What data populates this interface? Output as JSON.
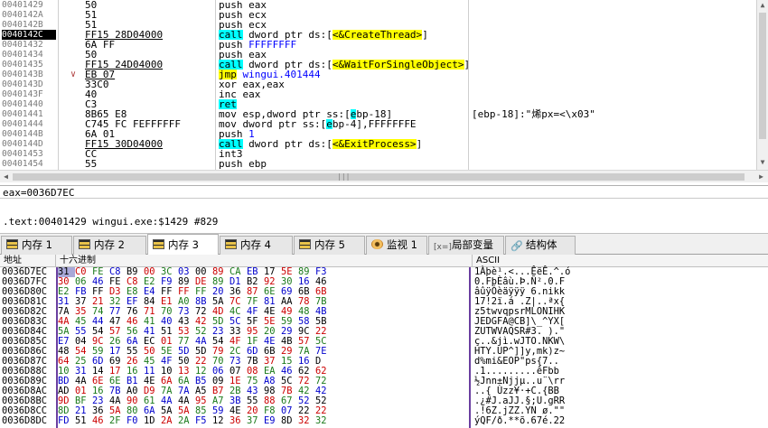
{
  "disasm": {
    "rows": [
      {
        "addr": "00401429",
        "arrow": "",
        "bytes": "50",
        "mnemonic": "push",
        "operand": "eax",
        "style": "push",
        "comment": ""
      },
      {
        "addr": "0040142A",
        "arrow": "",
        "bytes": "51",
        "mnemonic": "push",
        "operand": "ecx",
        "style": "push",
        "comment": ""
      },
      {
        "addr": "0040142B",
        "arrow": "",
        "bytes": "51",
        "mnemonic": "push",
        "operand": "ecx",
        "style": "push",
        "comment": ""
      },
      {
        "addr": "0040142C",
        "arrow": "",
        "bytes": "FF15 28D04000",
        "mnemonic": "call",
        "operand": "dword ptr ds:[<&CreateThread>]",
        "style": "call",
        "comment": "",
        "selected": true
      },
      {
        "addr": "00401432",
        "arrow": "",
        "bytes": "6A FF",
        "mnemonic": "push",
        "operand": "FFFFFFFF",
        "style": "pushimm",
        "comment": ""
      },
      {
        "addr": "00401434",
        "arrow": "",
        "bytes": "50",
        "mnemonic": "push",
        "operand": "eax",
        "style": "push",
        "comment": ""
      },
      {
        "addr": "00401435",
        "arrow": "",
        "bytes": "FF15 24D04000",
        "mnemonic": "call",
        "operand": "dword ptr ds:[<&WaitForSingleObject>]",
        "style": "call",
        "comment": ""
      },
      {
        "addr": "0040143B",
        "arrow": "∨",
        "bytes": "EB 07",
        "mnemonic": "jmp",
        "operand": "wingui.401444",
        "style": "jmp",
        "comment": ""
      },
      {
        "addr": "0040143D",
        "arrow": "",
        "bytes": "33C0",
        "mnemonic": "xor",
        "operand": "eax,eax",
        "style": "plain",
        "comment": ""
      },
      {
        "addr": "0040143F",
        "arrow": "",
        "bytes": "40",
        "mnemonic": "inc",
        "operand": "eax",
        "style": "plain",
        "comment": ""
      },
      {
        "addr": "00401440",
        "arrow": "",
        "bytes": "C3",
        "mnemonic": "ret",
        "operand": "",
        "style": "ret",
        "comment": ""
      },
      {
        "addr": "00401441",
        "arrow": "",
        "bytes": "8B65 E8",
        "mnemonic": "mov",
        "operand": "esp,dword ptr ss:[ebp-18]",
        "style": "movss",
        "comment": "[ebp-18]:\"烯px=<\\x03\""
      },
      {
        "addr": "00401444",
        "arrow": "",
        "bytes": "C745 FC FEFFFFFF",
        "mnemonic": "mov",
        "operand": "dword ptr ss:[ebp-4],FFFFFFFE",
        "style": "movss2",
        "comment": ""
      },
      {
        "addr": "0040144B",
        "arrow": "",
        "bytes": "6A 01",
        "mnemonic": "push",
        "operand": "1",
        "style": "pushimm",
        "comment": ""
      },
      {
        "addr": "0040144D",
        "arrow": "",
        "bytes": "FF15 30D04000",
        "mnemonic": "call",
        "operand": "dword ptr ds:[<&ExitProcess>]",
        "style": "call",
        "comment": ""
      },
      {
        "addr": "00401453",
        "arrow": "",
        "bytes": "CC",
        "mnemonic": "int3",
        "operand": "",
        "style": "plain",
        "comment": ""
      },
      {
        "addr": "00401454",
        "arrow": "",
        "bytes": "55",
        "mnemonic": "push",
        "operand": "ebp",
        "style": "push",
        "comment": ""
      }
    ]
  },
  "info": {
    "line1": "eax=0036D7EC",
    "line2": ".text:00401429 wingui.exe:$1429 #829"
  },
  "tabs": [
    {
      "label": "内存 1",
      "icon": "memory-icon",
      "active": false
    },
    {
      "label": "内存 2",
      "icon": "memory-icon",
      "active": false
    },
    {
      "label": "内存 3",
      "icon": "memory-icon",
      "active": true
    },
    {
      "label": "内存 4",
      "icon": "memory-icon",
      "active": false
    },
    {
      "label": "内存 5",
      "icon": "memory-icon",
      "active": false
    },
    {
      "label": "监视 1",
      "icon": "watch-icon",
      "active": false
    },
    {
      "label": "局部变量",
      "icon": "locals-icon",
      "active": false
    },
    {
      "label": "结构体",
      "icon": "struct-icon",
      "active": false
    }
  ],
  "dump": {
    "headers": {
      "address": "地址",
      "hex": "十六进制",
      "ascii": "ASCII"
    },
    "rows": [
      {
        "addr": "0036D7EC",
        "hex": [
          "31",
          "C0",
          "FE",
          "C8",
          "B9",
          "00",
          "3C",
          "03",
          "00",
          "89",
          "CA",
          "EB",
          "17",
          "5E",
          "89",
          "F3"
        ],
        "ascii": "1Àþè¹.<...ÊëÊ.^.ó"
      },
      {
        "addr": "0036D7FC",
        "hex": [
          "30",
          "06",
          "46",
          "FE",
          "C8",
          "E2",
          "F9",
          "89",
          "DE",
          "89",
          "D1",
          "B2",
          "92",
          "30",
          "16",
          "46"
        ],
        "ascii": "0.FþÈâù.Þ.Ñ².0.F"
      },
      {
        "addr": "0036D80C",
        "hex": [
          "E2",
          "FB",
          "FF",
          "D3",
          "E8",
          "E4",
          "FF",
          "FF",
          "FF",
          "20",
          "36",
          "87",
          "6E",
          "69",
          "6B",
          "6B"
        ],
        "ascii": "âûÿÓèäÿÿÿ 6.nikk"
      },
      {
        "addr": "0036D81C",
        "hex": [
          "31",
          "37",
          "21",
          "32",
          "EF",
          "84",
          "E1",
          "A0",
          "8B",
          "5A",
          "7C",
          "7F",
          "81",
          "AA",
          "78",
          "7B"
        ],
        "ascii": "17!2ï.á .Z|..ªx{"
      },
      {
        "addr": "0036D82C",
        "hex": [
          "7A",
          "35",
          "74",
          "77",
          "76",
          "71",
          "70",
          "73",
          "72",
          "4D",
          "4C",
          "4F",
          "4E",
          "49",
          "48",
          "4B"
        ],
        "ascii": "z5twvqpsrMLONIHK"
      },
      {
        "addr": "0036D83C",
        "hex": [
          "4A",
          "45",
          "44",
          "47",
          "46",
          "41",
          "40",
          "43",
          "42",
          "5D",
          "5C",
          "5F",
          "5E",
          "59",
          "58",
          "5B"
        ],
        "ascii": "JEDGFA@CB]\\_^YX["
      },
      {
        "addr": "0036D84C",
        "hex": [
          "5A",
          "55",
          "54",
          "57",
          "56",
          "41",
          "51",
          "53",
          "52",
          "23",
          "33",
          "95",
          "20",
          "29",
          "9C",
          "22"
        ],
        "ascii": "ZUTWVAQSR#3. ).\""
      },
      {
        "addr": "0036D85C",
        "hex": [
          "E7",
          "04",
          "9C",
          "26",
          "6A",
          "EC",
          "01",
          "77",
          "4A",
          "54",
          "4F",
          "1F",
          "4E",
          "4B",
          "57",
          "5C"
        ],
        "ascii": "ç..&jì.wJTO.NKW\\"
      },
      {
        "addr": "0036D86C",
        "hex": [
          "48",
          "54",
          "59",
          "17",
          "55",
          "50",
          "5E",
          "5D",
          "5D",
          "79",
          "2C",
          "6D",
          "6B",
          "29",
          "7A",
          "7E"
        ],
        "ascii": "HTY.UP^]]y,mk)z~"
      },
      {
        "addr": "0036D87C",
        "hex": [
          "64",
          "25",
          "6D",
          "69",
          "26",
          "45",
          "4F",
          "50",
          "22",
          "70",
          "73",
          "7B",
          "37",
          "15",
          "16",
          "D"
        ],
        "ascii": "d%mi&EOP\"ps{7.."
      },
      {
        "addr": "0036D88C",
        "hex": [
          "10",
          "31",
          "14",
          "17",
          "16",
          "11",
          "10",
          "13",
          "12",
          "06",
          "07",
          "08",
          "EA",
          "46",
          "62",
          "62"
        ],
        "ascii": ".1.........êFbb"
      },
      {
        "addr": "0036D89C",
        "hex": [
          "BD",
          "4A",
          "6E",
          "6E",
          "B1",
          "4E",
          "6A",
          "6A",
          "B5",
          "09",
          "1E",
          "75",
          "A8",
          "5C",
          "72",
          "72"
        ],
        "ascii": "½Jnn±Njjµ..u¨\\rr"
      },
      {
        "addr": "0036D8AC",
        "hex": [
          "AD",
          "01",
          "16",
          "7B",
          "A0",
          "D9",
          "7A",
          "7A",
          "A5",
          "B7",
          "2B",
          "43",
          "98",
          "7B",
          "42",
          "42"
        ],
        "ascii": "­..{ Ùzz¥·+C.{BB"
      },
      {
        "addr": "0036D8BC",
        "hex": [
          "9D",
          "BF",
          "23",
          "4A",
          "90",
          "61",
          "4A",
          "4A",
          "95",
          "A7",
          "3B",
          "55",
          "88",
          "67",
          "52",
          "52"
        ],
        "ascii": ".¿#J.aJJ.§;U.gRR"
      },
      {
        "addr": "0036D8CC",
        "hex": [
          "8D",
          "21",
          "36",
          "5A",
          "80",
          "6A",
          "5A",
          "5A",
          "85",
          "59",
          "4E",
          "20",
          "F8",
          "07",
          "22",
          "22"
        ],
        "ascii": ".!6Z.jZZ.YN ø.\"\""
      },
      {
        "addr": "0036D8DC",
        "hex": [
          "FD",
          "51",
          "46",
          "2F",
          "F0",
          "1D",
          "2A",
          "2A",
          "F5",
          "12",
          "36",
          "37",
          "E9",
          "8D",
          "32",
          "32"
        ],
        "ascii": "ýQF/ð.**õ.67é.22"
      }
    ]
  }
}
